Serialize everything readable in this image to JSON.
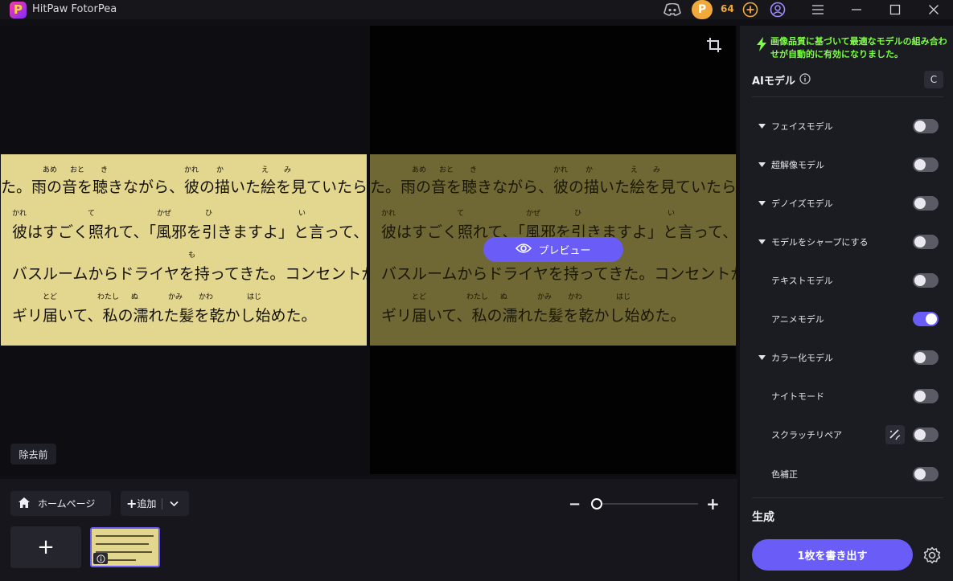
{
  "app": {
    "title": "HitPaw FotorPea",
    "coins": "64",
    "coin_symbol": "P",
    "logo_letter": "P"
  },
  "canvas": {
    "before_label": "除去前",
    "preview_label": "プレビュー",
    "image_text": {
      "lines": [
        "た。雨の音を聴きながら、彼の描いた絵を見ていたら、",
        "彼はすごく照れて、「風邪を引きますよ」と言って、",
        "バスルームからドライヤを持ってきた。コンセントが",
        "ギリ届いて、私の濡れた髪を乾かし始めた。"
      ],
      "ruby": [
        {
          "text": "あめ",
          "line": 0
        },
        {
          "text": "おと",
          "line": 0
        },
        {
          "text": "き",
          "line": 0
        },
        {
          "text": "かれ",
          "line": 0
        },
        {
          "text": "か",
          "line": 0
        },
        {
          "text": "え",
          "line": 0
        },
        {
          "text": "み",
          "line": 0
        },
        {
          "text": "かれ",
          "line": 1
        },
        {
          "text": "て",
          "line": 1
        },
        {
          "text": "かぜ",
          "line": 1
        },
        {
          "text": "ひ",
          "line": 1
        },
        {
          "text": "い",
          "line": 1
        },
        {
          "text": "も",
          "line": 2
        },
        {
          "text": "とど",
          "line": 3
        },
        {
          "text": "わたし",
          "line": 3
        },
        {
          "text": "ぬ",
          "line": 3
        },
        {
          "text": "かみ",
          "line": 3
        },
        {
          "text": "かわ",
          "line": 3
        },
        {
          "text": "はじ",
          "line": 3
        }
      ]
    }
  },
  "bottom": {
    "home_label": "ホームページ",
    "add_label": "追加",
    "zoom_level": 0.0
  },
  "sidebar": {
    "banner": "画像品質に基づいて最適なモデルの組み合わせが自動的に有効になりました。",
    "ai_models_title": "AIモデル",
    "refresh_label": "C",
    "models": [
      {
        "label": "フェイスモデル",
        "expandable": true,
        "on": false
      },
      {
        "label": "超解像モデル",
        "expandable": true,
        "on": false
      },
      {
        "label": "デノイズモデル",
        "expandable": true,
        "on": false
      },
      {
        "label": "モデルをシャープにする",
        "expandable": true,
        "on": false
      },
      {
        "label": "テキストモデル",
        "expandable": false,
        "on": false
      },
      {
        "label": "アニメモデル",
        "expandable": false,
        "on": true
      },
      {
        "label": "カラー化モデル",
        "expandable": true,
        "on": false
      },
      {
        "label": "ナイトモード",
        "expandable": false,
        "on": false
      },
      {
        "label": "スクラッチリペア",
        "expandable": false,
        "on": false
      },
      {
        "label": "色補正",
        "expandable": false,
        "on": false
      }
    ],
    "generate_title": "生成",
    "export_label": "1枚を書き出す"
  },
  "colors": {
    "accent": "#6a5cf6",
    "banner": "#7dff44",
    "coin": "#f2a93b"
  }
}
